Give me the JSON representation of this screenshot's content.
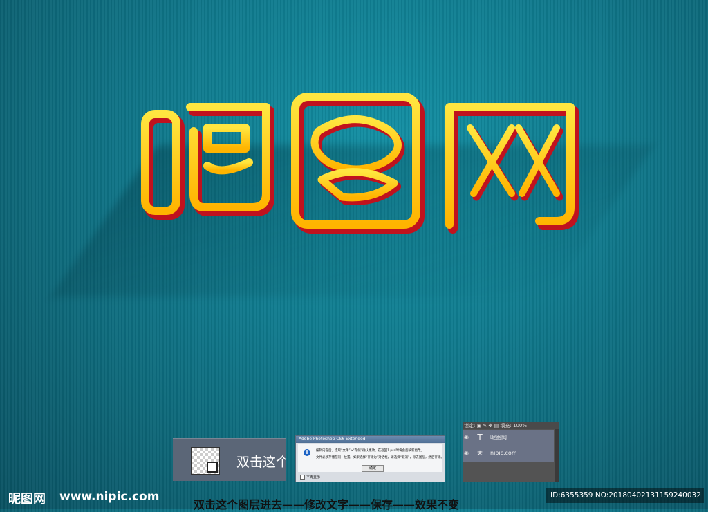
{
  "canvas": {
    "background_color": "#0f7a8d",
    "title_text": "昵图网"
  },
  "tutorial": {
    "layer_thumbnail_label": "双击这个",
    "dialog": {
      "title": "Adobe Photoshop CS6 Extended",
      "message_line1": "编辑内容后，选取“文件”>“存储”确认更改。在返回1.psd时将会反映新更改。",
      "message_line2": "文件必须存储在同一位置。如果选择“存储为”对话框，请选择“取消”，除去图层，然后存储。",
      "ok_button": "确定",
      "checkbox_label": "不再显示"
    },
    "layers_panel": {
      "toolbar_text": "锁定: ▣ ✎ ✥ ▤  填充: 100%",
      "rows": [
        {
          "name": "昵图网",
          "icon": "T"
        },
        {
          "name": "nipic.com",
          "icon": "ㅊ"
        }
      ]
    }
  },
  "footer": {
    "logo_text": "昵图网",
    "url": "www.nipic.com",
    "caption": "双击这个图层进去——修改文字——保存——效果不变",
    "id_text": "ID:6355359 NO:20180402131159240032"
  },
  "colors": {
    "gold": "#ffd200",
    "gold_dark": "#e8a400",
    "red_edge": "#c0121e",
    "teal": "#0f7a8d"
  }
}
